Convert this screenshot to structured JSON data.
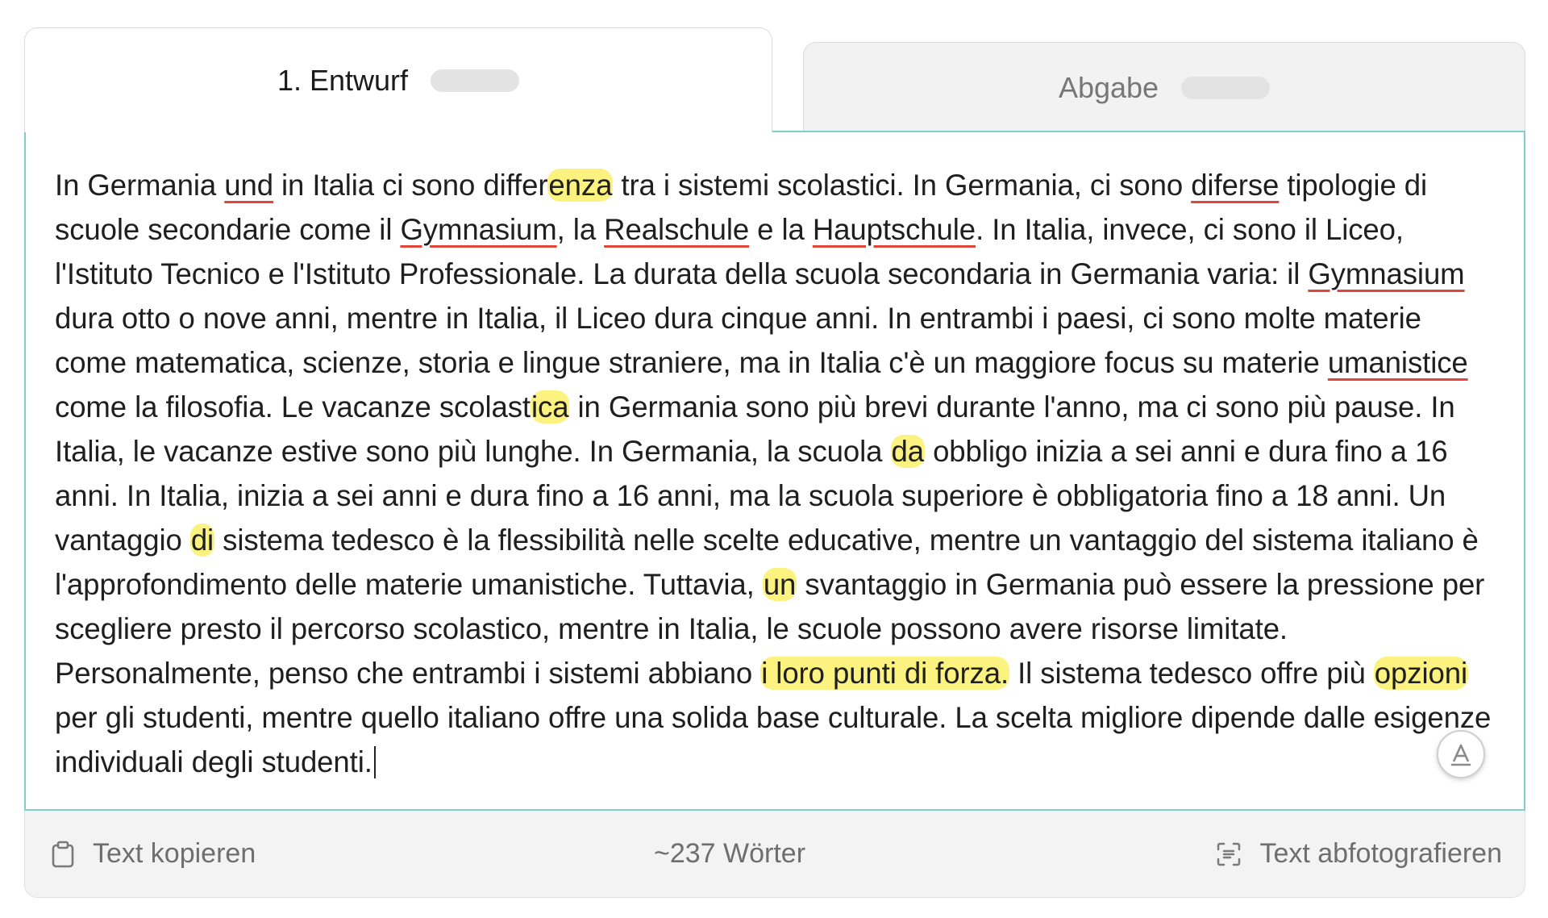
{
  "tabs": [
    {
      "label": "1. Entwurf",
      "active": true
    },
    {
      "label": "Abgabe",
      "active": false
    }
  ],
  "essay": {
    "segments": [
      {
        "t": "In Germania "
      },
      {
        "t": "und",
        "s": "u"
      },
      {
        "t": " in Italia ci sono differ"
      },
      {
        "t": "enza",
        "s": "h"
      },
      {
        "t": " tra i sistemi scolastici. In Germania, ci sono "
      },
      {
        "t": "diferse",
        "s": "u"
      },
      {
        "t": " tipologie di scuole secondarie come il "
      },
      {
        "t": "Gymnasium",
        "s": "u"
      },
      {
        "t": ", la "
      },
      {
        "t": "Realschule",
        "s": "u"
      },
      {
        "t": " e la "
      },
      {
        "t": "Hauptschule",
        "s": "u"
      },
      {
        "t": ". In Italia, invece, ci sono il Liceo, l'Istituto Tecnico e l'Istituto Professionale. La durata della scuola secondaria in Germania varia: il "
      },
      {
        "t": "Gymnasium",
        "s": "u"
      },
      {
        "t": " dura otto o nove anni, mentre in Italia, il Liceo dura cinque anni. In entrambi i paesi, ci sono molte materie come matematica, scienze, storia e lingue straniere, ma in Italia c'è un maggiore focus su materie "
      },
      {
        "t": "umanistice",
        "s": "u"
      },
      {
        "t": " come la filosofia. Le vacanze scolast"
      },
      {
        "t": "ica",
        "s": "h"
      },
      {
        "t": " in Germania sono più brevi durante l'anno, ma ci sono più pause. In Italia, le vacanze estive sono più lunghe. In Germania, la scuola "
      },
      {
        "t": "da",
        "s": "h"
      },
      {
        "t": " obbligo inizia a sei anni e dura fino a 16 anni. In Italia, inizia a sei anni e dura fino a 16 anni, ma la scuola superiore è obbligatoria fino a 18 anni. Un vantaggio "
      },
      {
        "t": "di",
        "s": "h"
      },
      {
        "t": " sistema tedesco è la flessibilità nelle scelte educative, mentre un vantaggio del sistema italiano è l'approfondimento delle materie umanistiche. Tuttavia, "
      },
      {
        "t": "un",
        "s": "h"
      },
      {
        "t": " svantaggio in Germania può essere la pressione per scegliere presto il percorso scolastico, mentre in Italia, le scuole possono avere risorse limitate. Personalmente, penso che entrambi i sistemi abbiano "
      },
      {
        "t": "i loro punti di forza.",
        "s": "h"
      },
      {
        "t": " Il sistema tedesco offre più "
      },
      {
        "t": "opzioni",
        "s": "h"
      },
      {
        "t": " per gli studenti, mentre quello italiano offre una solida base culturale. La scelta migliore dipende dalle esigenze individuali degli studenti."
      }
    ]
  },
  "footer": {
    "copy_label": "Text kopieren",
    "word_count": "~237 Wörter",
    "photo_label": "Text abfotografieren"
  },
  "colors": {
    "highlight": "#fbf27f",
    "error_underline": "#e0463a",
    "editor_border": "#7fcfc7"
  },
  "icons": {
    "copy": "clipboard-icon",
    "photo": "scan-text-icon",
    "grammar": "grammar-check-icon"
  }
}
